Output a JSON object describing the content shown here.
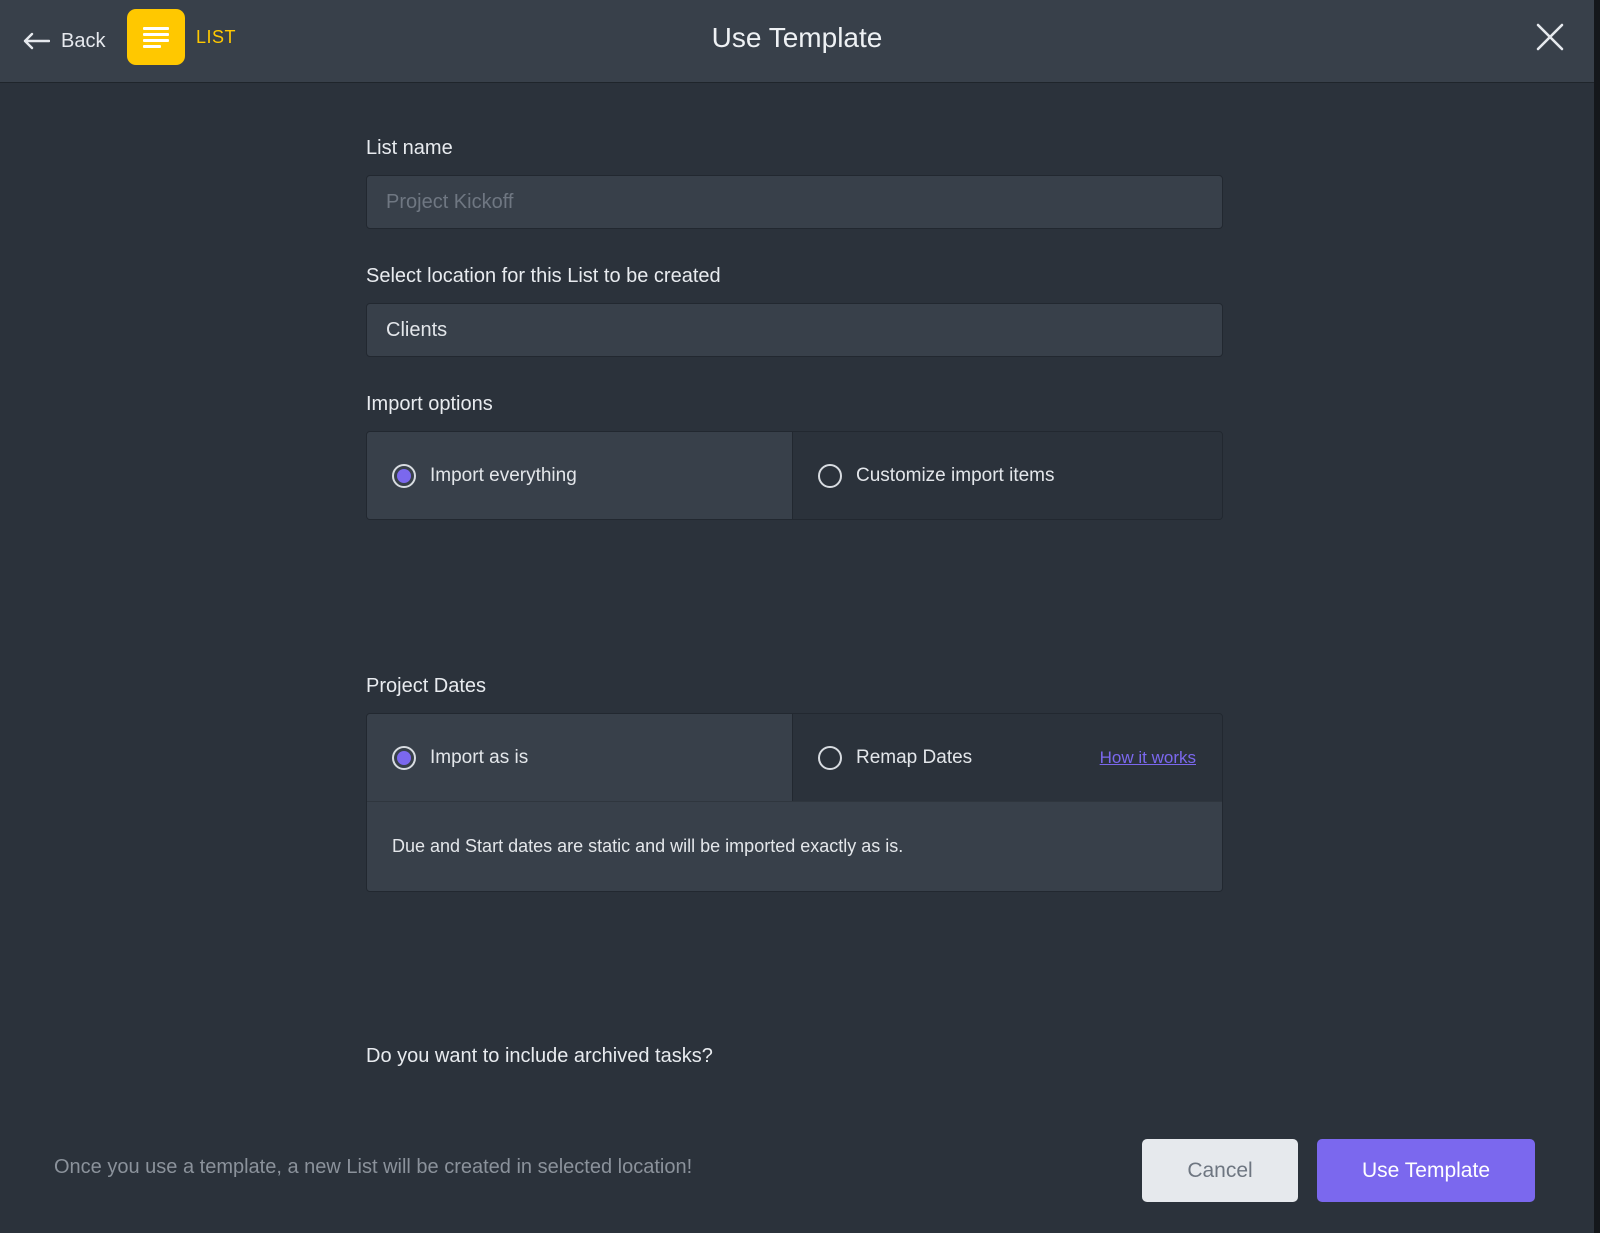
{
  "header": {
    "back_label": "Back",
    "type_label": "LIST",
    "title": "Use Template"
  },
  "form": {
    "list_name_label": "List name",
    "list_name_placeholder": "Project Kickoff",
    "list_name_value": "",
    "location_label": "Select location for this List to be created",
    "location_value": "Clients",
    "import_label": "Import options",
    "import_options": [
      {
        "label": "Import everything",
        "checked": true
      },
      {
        "label": "Customize import items",
        "checked": false
      }
    ],
    "dates_label": "Project Dates",
    "dates_options": [
      {
        "label": "Import as is",
        "checked": true
      },
      {
        "label": "Remap Dates",
        "checked": false
      }
    ],
    "how_it_works": "How it works",
    "dates_description": "Due and Start dates are static and will be imported exactly as is.",
    "archived_label": "Do you want to include archived tasks?"
  },
  "footer": {
    "note": "Once you use a template, a new List will be created in selected location!",
    "cancel_label": "Cancel",
    "submit_label": "Use Template"
  },
  "colors": {
    "accent": "#7b68ee",
    "list_badge": "#ffc800",
    "background": "#2b323b",
    "header": "#38404a"
  },
  "icons": [
    "back-arrow-icon",
    "list-icon",
    "close-icon"
  ]
}
